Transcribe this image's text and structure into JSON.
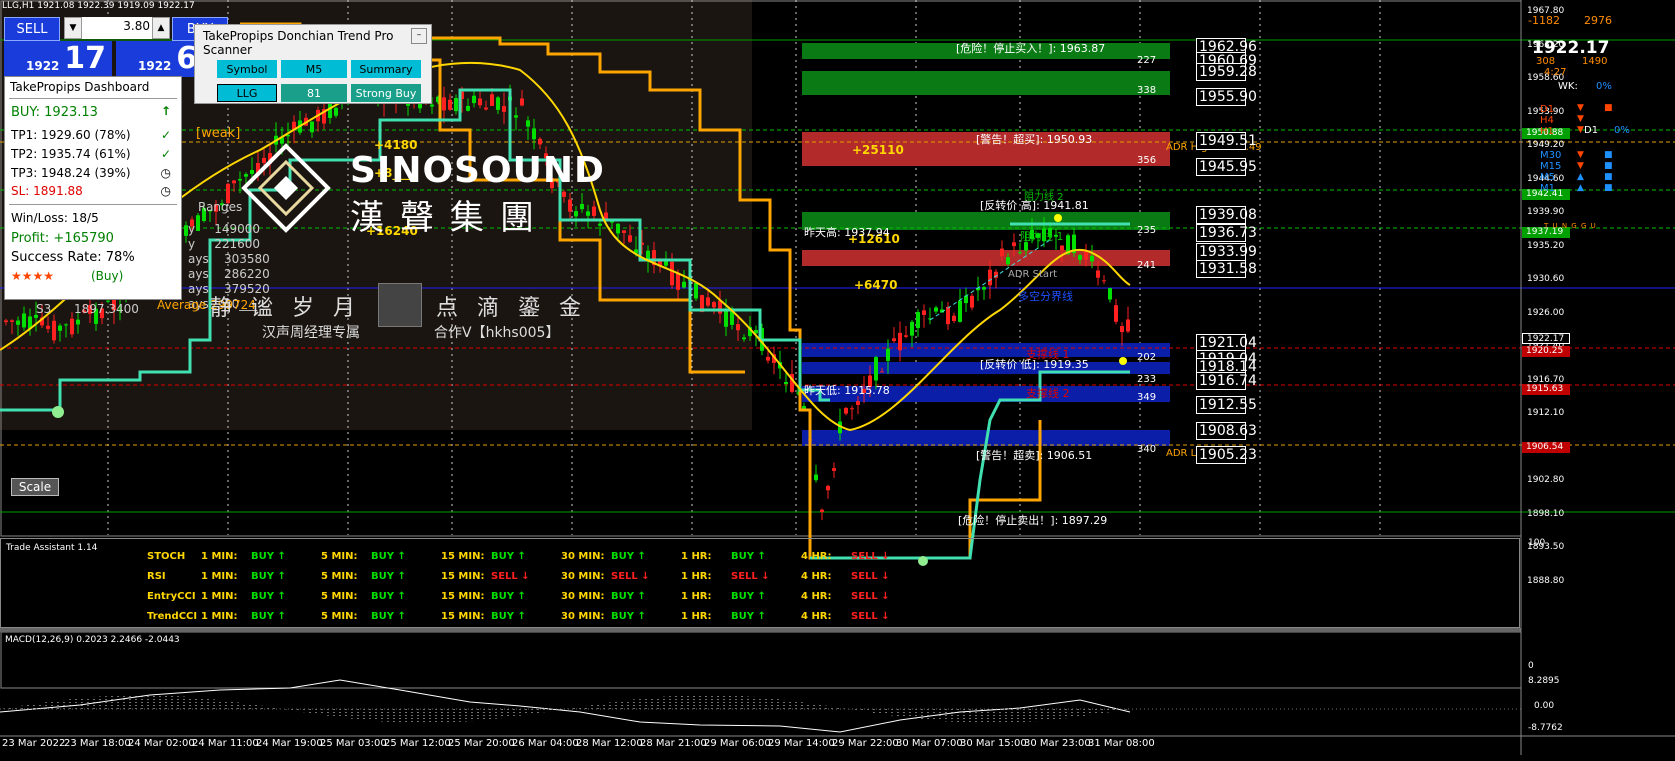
{
  "symbol_title": "LLG,H1  1921.08 1922.39 1919.09 1922.17",
  "one_click": {
    "sell_label": "SELL",
    "buy_label": "BUY",
    "lot": "3.80",
    "bid_small": "1922",
    "bid_big": "17",
    "ask_small": "1922",
    "ask_big": "67"
  },
  "dashboard": {
    "title": "TakePropips Dashboard",
    "buy": "BUY: 1923.13",
    "tp1": "TP1: 1929.60 (78%)",
    "tp2": "TP2: 1935.74 (61%)",
    "tp3": "TP3: 1948.24 (39%)",
    "sl": "SL:  1891.88",
    "winloss": "Win/Loss: 18/5",
    "profit": "Profit: +165790",
    "success": "Success Rate: 78%",
    "stars": "★★★★",
    "stars_label": "(Buy)",
    "colors": {
      "buy": "#008000",
      "sl": "#e00000",
      "stars": "#ff4500"
    }
  },
  "scanner": {
    "title": "TakePropips Donchian Trend Pro Scanner",
    "headers": [
      "Symbol",
      "M5",
      "Summary"
    ],
    "values": [
      "LLG",
      "81",
      "Strong Buy"
    ]
  },
  "watermark": {
    "brand_en": "SINOSOUND",
    "brand_cn": "漢聲集團",
    "line1": "静  谧  岁  月",
    "line2": "点  滴  鎏  金",
    "caption1": "汉声周经理专属",
    "caption2": "合作V【hkhs005】"
  },
  "left_overlay": {
    "weak": "[weak]",
    "ranges": "Ranges",
    "rows": [
      {
        "label": "y",
        "value": "149000"
      },
      {
        "label": "y",
        "value": "221600"
      },
      {
        "label": "ays",
        "value": "303580"
      },
      {
        "label": "ays",
        "value": "286220"
      },
      {
        "label": "ays",
        "value": "379520"
      },
      {
        "label": "ays",
        "value": "30___"
      }
    ],
    "average": "Average  299724",
    "s3": "S3",
    "s3_value": "1897.3400",
    "pnl1": "+4180",
    "pnl2": "+16240",
    "pnl3": "+12610",
    "pnl4": "+6470",
    "pnl5": "+25110",
    "pnl6": "+8___"
  },
  "zone_labels": [
    {
      "text": "[危险！停止买入！]: 1963.87",
      "num": "227"
    },
    {
      "text": "",
      "num": "338"
    },
    {
      "text": "[警告！超买]: 1950.93",
      "num": "356"
    },
    {
      "text": "[反转价 高]: 1941.81",
      "num": ""
    },
    {
      "text": "",
      "num": "235"
    },
    {
      "text": "",
      "num": "241"
    },
    {
      "text": "[反转价 低]: 1919.35",
      "num": "202"
    },
    {
      "text": "",
      "num": "233"
    },
    {
      "text": "",
      "num": "349"
    },
    {
      "text": "[警告！超卖]: 1906.51",
      "num": "340"
    },
    {
      "text": "[危险！停止卖出！]: 1897.29",
      "num": ""
    }
  ],
  "chart_labels": {
    "prev_high": "昨天高: 1937.94",
    "prev_low": "昨天低: 1915.78",
    "adr_start": "ADR Start",
    "adr_high": "ADR High: 1949.49",
    "adr_low": "ADR Low",
    "support1": "支撑线 1",
    "support2": "支撑线 2",
    "resist1": "阻力线 1",
    "resist2": "阻力线 2",
    "pivot": "多空分界线"
  },
  "level_boxes": [
    "1962.96",
    "1960.69",
    "1959.28",
    "1955.90",
    "1949.51",
    "1945.95",
    "1939.08",
    "1936.73",
    "1933.99",
    "1931.58",
    "1921.04",
    "1919.04",
    "1918.14",
    "1916.74",
    "1912.55",
    "1908.63",
    "1905.23"
  ],
  "price_axis": [
    "1967.80",
    "1963.20",
    "1958.60",
    "1953.90",
    "1949.20",
    "1944.60",
    "1939.90",
    "1935.20",
    "1930.60",
    "1926.00",
    "1921.40",
    "1916.70",
    "1912.10",
    "1907.40",
    "1902.80",
    "1898.10",
    "1893.50",
    "1888.80"
  ],
  "price_tags": [
    {
      "value": "1950.88",
      "color": "#00a000"
    },
    {
      "value": "1942.41",
      "color": "#00a000"
    },
    {
      "value": "1937.19",
      "color": "#00a000"
    },
    {
      "value": "1922.17",
      "color": "#000000"
    },
    {
      "value": "1920.25",
      "color": "#c00000"
    },
    {
      "value": "1915.63",
      "color": "#c00000"
    },
    {
      "value": "1906.54",
      "color": "#c00000"
    }
  ],
  "top_right": {
    "v1": "-1182",
    "v2": "2976",
    "price": "1922.17",
    "v3": "308",
    "v4": "1490",
    "time": "4:27",
    "wk": "WK:",
    "wk_pct": "0%",
    "tf_left": [
      "D1",
      "H4",
      "H1"
    ],
    "tf_right": [
      "M30",
      "M15",
      "M5",
      "M1"
    ],
    "d1": "D1",
    "d1_pct": "0%",
    "brand": "T U N G G U"
  },
  "trade_assistant": {
    "title": "Trade Assistant 1.14",
    "timeframes": [
      "1 MIN:",
      "5 MIN:",
      "15 MIN:",
      "30 MIN:",
      "1 HR:",
      "4 HR:"
    ],
    "rows": [
      {
        "name": "STOCH",
        "signals": [
          "BUY",
          "BUY",
          "BUY",
          "BUY",
          "BUY",
          "SELL"
        ]
      },
      {
        "name": "RSI",
        "signals": [
          "BUY",
          "BUY",
          "SELL",
          "SELL",
          "SELL",
          "SELL"
        ]
      },
      {
        "name": "EntryCCI",
        "signals": [
          "BUY",
          "BUY",
          "BUY",
          "BUY",
          "BUY",
          "SELL"
        ]
      },
      {
        "name": "TrendCCI",
        "signals": [
          "BUY",
          "BUY",
          "BUY",
          "BUY",
          "BUY",
          "SELL"
        ]
      }
    ],
    "scale_top": "100",
    "scale_bottom": "0"
  },
  "macd": {
    "title": "MACD(12,26,9) 0.2023 2.2466 -2.0443",
    "axis": [
      "8.2895",
      "0.00",
      "-8.7762"
    ]
  },
  "time_axis": [
    "23 Mar 2022",
    "23 Mar 18:00",
    "24 Mar 02:00",
    "24 Mar 11:00",
    "24 Mar 19:00",
    "25 Mar 03:00",
    "25 Mar 12:00",
    "25 Mar 20:00",
    "26 Mar 04:00",
    "28 Mar 12:00",
    "28 Mar 21:00",
    "29 Mar 06:00",
    "29 Mar 14:00",
    "29 Mar 22:00",
    "30 Mar 07:00",
    "30 Mar 15:00",
    "30 Mar 23:00",
    "31 Mar 08:00"
  ],
  "scale_button": "Scale",
  "colors": {
    "green_zone": "#007a10",
    "red_zone": "#a82a2a",
    "blue_zone": "#0b1ea8",
    "orange_line": "#ffa500",
    "yellow_line": "#ffd700",
    "trend_line": "#40e0b0"
  }
}
